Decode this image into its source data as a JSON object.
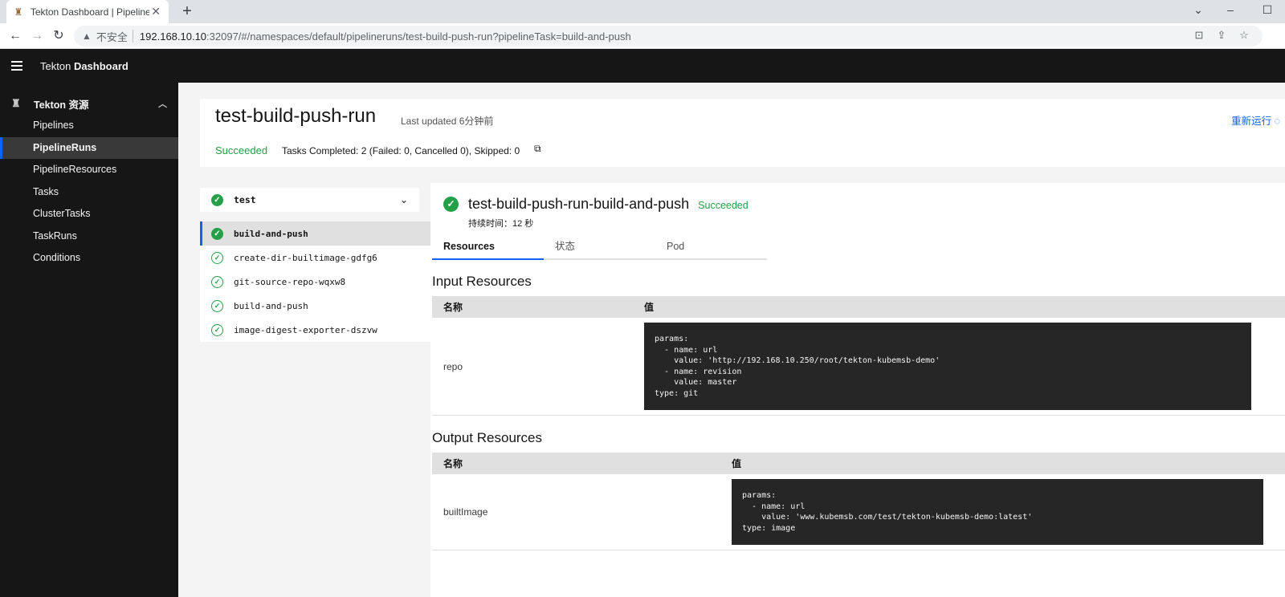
{
  "browser": {
    "tab_title": "Tekton Dashboard | PipelineRuns",
    "insecure_label": "不安全",
    "url_host": "192.168.10.10",
    "url_rest": ":32097/#/namespaces/default/pipelineruns/test-build-push-run?pipelineTask=build-and-push"
  },
  "header": {
    "brand": "Tekton",
    "product": "Dashboard"
  },
  "sidebar": {
    "group_label": "Tekton 资源",
    "items": [
      {
        "label": "Pipelines"
      },
      {
        "label": "PipelineRuns"
      },
      {
        "label": "PipelineResources"
      },
      {
        "label": "Tasks"
      },
      {
        "label": "ClusterTasks"
      },
      {
        "label": "TaskRuns"
      },
      {
        "label": "Conditions"
      }
    ]
  },
  "run": {
    "title": "test-build-push-run",
    "last_updated": "Last updated 6分钟前",
    "rerun_label": "重新运行",
    "status": "Succeeded",
    "tasks_summary": "Tasks Completed: 2 (Failed: 0, Cancelled 0), Skipped: 0"
  },
  "tree": {
    "task": "test",
    "steps": [
      {
        "label": "build-and-push"
      },
      {
        "label": "create-dir-builtimage-gdfg6"
      },
      {
        "label": "git-source-repo-wqxw8"
      },
      {
        "label": "build-and-push"
      },
      {
        "label": "image-digest-exporter-dszvw"
      }
    ]
  },
  "details": {
    "title": "test-build-push-run-build-and-push",
    "status": "Succeeded",
    "duration": "持续时间：12 秒",
    "tabs": [
      {
        "label": "Resources"
      },
      {
        "label": "状态"
      },
      {
        "label": "Pod"
      }
    ],
    "input": {
      "title": "Input Resources",
      "col_name": "名称",
      "col_value": "值",
      "rows": [
        {
          "name": "repo",
          "value": "params:\n  - name: url\n    value: 'http://192.168.10.250/root/tekton-kubemsb-demo'\n  - name: revision\n    value: master\ntype: git"
        }
      ]
    },
    "output": {
      "title": "Output Resources",
      "col_name": "名称",
      "col_value": "值",
      "rows": [
        {
          "name": "builtImage",
          "value": "params:\n  - name: url\n    value: 'www.kubemsb.com/test/tekton-kubemsb-demo:latest'\ntype: image"
        }
      ]
    }
  }
}
